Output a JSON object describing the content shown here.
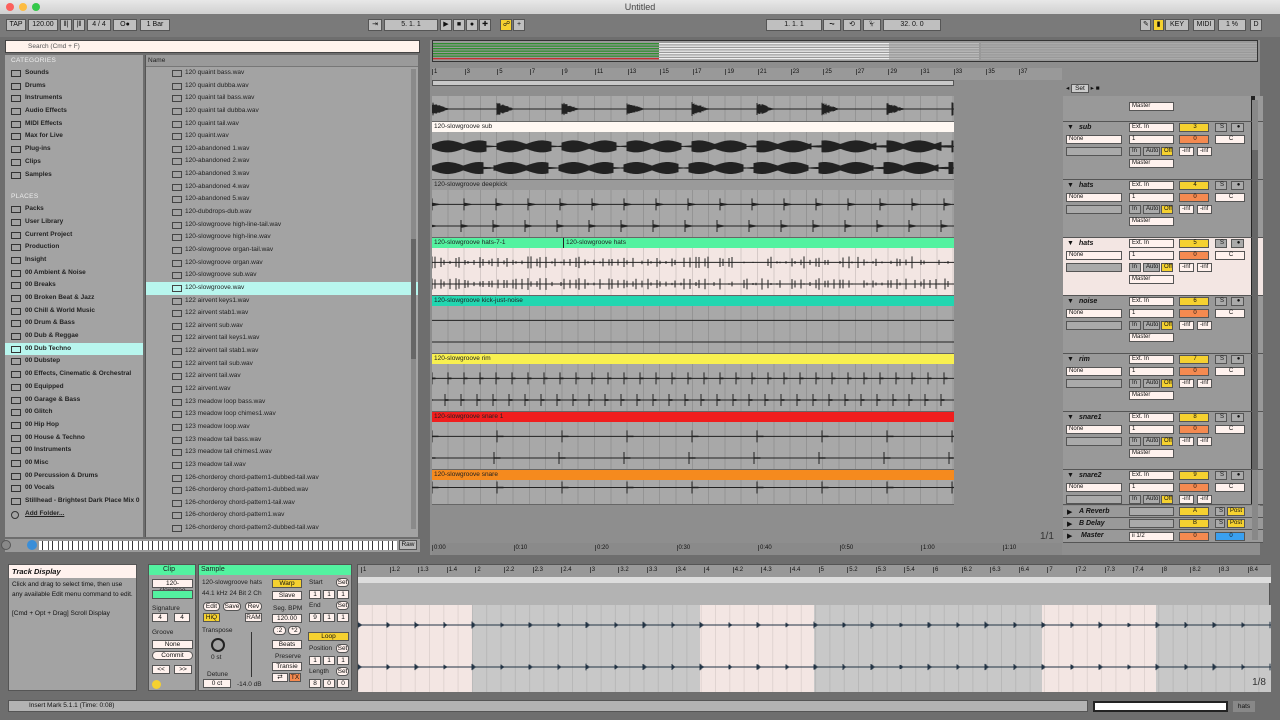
{
  "window": {
    "title": "Untitled"
  },
  "toolbar": {
    "tap": "TAP",
    "tempo": "120.00",
    "nudge_down": "⦀|",
    "nudge_up": "|⦀",
    "signature": "4 / 4",
    "metronome": "O●",
    "quantize": "1 Bar",
    "follow": "⇥",
    "position": "5.   1.   1",
    "arrangement_record": "☍",
    "draw": "+",
    "loop_start": "1.   1.   1",
    "punch_in": "⏦",
    "loop_toggle": "⟲",
    "punch_out": "⏧",
    "loop_length": "32.   0.   0",
    "pencil": "✎",
    "key": "KEY",
    "midi": "MIDI",
    "cpu": "1 %",
    "disk": "D"
  },
  "browser": {
    "search_placeholder": "Search (Cmd + F)",
    "categories_title": "CATEGORIES",
    "categories": [
      {
        "label": "Sounds",
        "icon": "note-icon"
      },
      {
        "label": "Drums",
        "icon": "grid-icon"
      },
      {
        "label": "Instruments",
        "icon": "wave-icon"
      },
      {
        "label": "Audio Effects",
        "icon": "effect-icon"
      },
      {
        "label": "MIDI Effects",
        "icon": "midi-effect-icon"
      },
      {
        "label": "Max for Live",
        "icon": "max-icon"
      },
      {
        "label": "Plug-ins",
        "icon": "plugin-icon"
      },
      {
        "label": "Clips",
        "icon": "clip-icon"
      },
      {
        "label": "Samples",
        "icon": "sample-icon"
      }
    ],
    "places_title": "PLACES",
    "places": [
      "Packs",
      "User Library",
      "Current Project",
      "Production",
      "Insight",
      "00 Ambient & Noise",
      "00 Breaks",
      "00 Broken Beat & Jazz",
      "00 Chill & World Music",
      "00 Drum & Bass",
      "00 Dub & Reggae",
      "00 Dub Techno",
      "00 Dubstep",
      "00 Effects, Cinematic & Orchestral",
      "00 Equipped",
      "00 Garage & Bass",
      "00 Glitch",
      "00 Hip Hop",
      "00 House & Techno",
      "00 Instruments",
      "00 Misc",
      "00 Percussion & Drums",
      "00 Vocals",
      "Stillhead - Brightest Dark Place Mix 0"
    ],
    "selected_place": "00 Dub Techno",
    "add_folder": "Add Folder...",
    "name_header": "Name",
    "files": [
      "120 quaint bass.wav",
      "120 quaint dubba.wav",
      "120 quaint tail bass.wav",
      "120 quaint tail dubba.wav",
      "120 quaint tail.wav",
      "120 quaint.wav",
      "120-abandoned 1.wav",
      "120-abandoned 2.wav",
      "120-abandoned 3.wav",
      "120-abandoned 4.wav",
      "120-abandoned 5.wav",
      "120-dubdrops-dub.wav",
      "120-slowgroove high-line-tail.wav",
      "120-slowgroove high-line.wav",
      "120-slowgroove organ-tail.wav",
      "120-slowgroove organ.wav",
      "120-slowgroove sub.wav",
      "120-slowgroove.wav",
      "122 airvent keys1.wav",
      "122 airvent stab1.wav",
      "122 airvent sub.wav",
      "122 airvent tail keys1.wav",
      "122 airvent tail stab1.wav",
      "122 airvent tail sub.wav",
      "122 airvent tail.wav",
      "122 airvent.wav",
      "123 meadow loop bass.wav",
      "123 meadow loop chimes1.wav",
      "123 meadow loop.wav",
      "123 meadow tail bass.wav",
      "123 meadow tail chimes1.wav",
      "123 meadow tail.wav",
      "126-chorderoy chord-pattern1-dubbed-tail.wav",
      "126-chorderoy chord-pattern1-dubbed.wav",
      "126-chorderoy chord-pattern1-tail.wav",
      "126-chorderoy chord-pattern1.wav",
      "126-chorderoy chord-pattern2-dubbed-tail.wav"
    ],
    "selected_file": "120-slowgroove.wav",
    "raw": "Raw"
  },
  "arrangement": {
    "bar_ticks": [
      "1",
      "3",
      "5",
      "7",
      "9",
      "11",
      "13",
      "15",
      "17",
      "19",
      "21",
      "23",
      "25",
      "27",
      "29",
      "31",
      "33",
      "35",
      "37"
    ],
    "time_ticks": [
      "0:00",
      "0:10",
      "0:20",
      "0:30",
      "0:40",
      "0:50",
      "1:00",
      "1:10"
    ],
    "set_label": "Set",
    "page": "1/1",
    "tracks": [
      {
        "name": "",
        "clips": [],
        "number": "",
        "output": "Master"
      },
      {
        "name": "sub",
        "clips": [
          {
            "label": "120-slowgroove sub",
            "color": "#fff8f3"
          }
        ],
        "number": "3",
        "input": "Ext. In",
        "input_channel": "None",
        "channel": "1",
        "monitor": [
          "In",
          "Auto",
          "Off"
        ],
        "output": "Master",
        "volume": "0",
        "pan": "C",
        "meters": [
          "-inf",
          "-inf"
        ],
        "solo": "S",
        "arm": "●"
      },
      {
        "name": "hats",
        "clips": [
          {
            "label": "120-slowgroove deepkick",
            "color": "#9a9a9a"
          }
        ],
        "number": "4",
        "input": "Ext. In",
        "input_channel": "None",
        "channel": "1",
        "monitor": [
          "In",
          "Auto",
          "Off"
        ],
        "output": "Master",
        "volume": "0",
        "pan": "C",
        "meters": [
          "-inf",
          "-inf"
        ],
        "solo": "S",
        "arm": "●"
      },
      {
        "name": "hats",
        "clips": [
          {
            "label": "120-slowgroove hats-7-1",
            "color": "#53f2a0"
          },
          {
            "label": "120-slowgroove hats",
            "color": "#53f2a0"
          }
        ],
        "number": "5",
        "input": "Ext. In",
        "input_channel": "None",
        "channel": "1",
        "monitor": [
          "In",
          "Auto",
          "Off"
        ],
        "output": "Master",
        "volume": "0",
        "pan": "C",
        "meters": [
          "-inf",
          "-inf"
        ],
        "solo": "S",
        "arm": "●",
        "selected": true
      },
      {
        "name": "noise",
        "clips": [
          {
            "label": "120-slowgroove kick-just-noise",
            "color": "#22d6b0"
          }
        ],
        "number": "6",
        "input": "Ext. In",
        "input_channel": "None",
        "channel": "1",
        "monitor": [
          "In",
          "Auto",
          "Off"
        ],
        "output": "Master",
        "volume": "0",
        "pan": "C",
        "meters": [
          "-inf",
          "-inf"
        ],
        "solo": "S",
        "arm": "●"
      },
      {
        "name": "rim",
        "clips": [
          {
            "label": "120-slowgroove rim",
            "color": "#f8f050"
          }
        ],
        "number": "7",
        "input": "Ext. In",
        "input_channel": "None",
        "channel": "1",
        "monitor": [
          "In",
          "Auto",
          "Off"
        ],
        "output": "Master",
        "volume": "0",
        "pan": "C",
        "meters": [
          "-inf",
          "-inf"
        ],
        "solo": "S",
        "arm": "●"
      },
      {
        "name": "snare1",
        "clips": [
          {
            "label": "120-slowgroove snare 1",
            "color": "#f01e1e"
          }
        ],
        "number": "8",
        "input": "Ext. In",
        "input_channel": "None",
        "channel": "1",
        "monitor": [
          "In",
          "Auto",
          "Off"
        ],
        "output": "Master",
        "volume": "0",
        "pan": "C",
        "meters": [
          "-inf",
          "-inf"
        ],
        "solo": "S",
        "arm": "●"
      },
      {
        "name": "snare2",
        "clips": [
          {
            "label": "120-slowgroove snare",
            "color": "#f58a1e"
          }
        ],
        "number": "9",
        "input": "Ext. In",
        "input_channel": "None",
        "channel": "1",
        "monitor": [
          "In",
          "Auto",
          "Off"
        ],
        "volume": "0",
        "pan": "C",
        "meters": [
          "-inf",
          "-inf"
        ],
        "solo": "S",
        "arm": "●"
      }
    ],
    "returns": [
      {
        "name": "A Reverb",
        "letter": "A",
        "solo": "S",
        "post": "Post"
      },
      {
        "name": "B Delay",
        "letter": "B",
        "solo": "S",
        "post": "Post"
      }
    ],
    "master": {
      "name": "Master",
      "cue": "ii 1/2",
      "volume": "0",
      "pan": "0"
    }
  },
  "info": {
    "title": "Track Display",
    "text": "Click and drag to select time, then use any available Edit menu command to edit.",
    "shortcut": "[Cmd + Opt + Drag] Scroll Display"
  },
  "clip": {
    "title": "Clip",
    "name": "120-slowgroo",
    "signature_label": "Signature",
    "sig_num": "4",
    "sig_den": "4",
    "groove_label": "Groove",
    "groove": "None",
    "commit": "Commit",
    "prev": "<<",
    "next": ">>"
  },
  "sample": {
    "title": "Sample",
    "file": "120-slowgroove hats",
    "format": "44.1 kHz 24 Bit 2 Ch",
    "edit": "Edit",
    "save": "Save",
    "rev": "Rev",
    "hiq": "HiQ",
    "ram": "RAM",
    "transpose_label": "Transpose",
    "transpose": "0 st",
    "detune_label": "Detune",
    "detune": "0 ct",
    "gain": "-14.0 dB",
    "warp": "Warp",
    "slave": "Slave",
    "seg_bpm_label": "Seg. BPM",
    "seg_bpm": "120.00",
    "half": ":2",
    "double": "*2",
    "warp_mode": "Beats",
    "preserve_label": "Preserve",
    "preserve": "Transie",
    "tx": "TX",
    "start_label": "Start",
    "start": [
      "1",
      "1",
      "1"
    ],
    "end_label": "End",
    "end": [
      "9",
      "1",
      "1"
    ],
    "set": "Set",
    "loop": "Loop",
    "position_label": "Position",
    "position": [
      "1",
      "1",
      "1"
    ],
    "length_label": "Length",
    "length": [
      "8",
      "0",
      "0"
    ]
  },
  "clip_editor": {
    "ticks": [
      "1",
      "1.2",
      "1.3",
      "1.4",
      "2",
      "2.2",
      "2.3",
      "2.4",
      "3",
      "3.2",
      "3.3",
      "3.4",
      "4",
      "4.2",
      "4.3",
      "4.4",
      "5",
      "5.2",
      "5.3",
      "5.4",
      "6",
      "6.2",
      "6.3",
      "6.4",
      "7",
      "7.2",
      "7.3",
      "7.4",
      "8",
      "8.2",
      "8.3",
      "8.4"
    ],
    "page": "1/8"
  },
  "status": {
    "text": "Insert Mark 5.1.1 (Time: 0:08)",
    "track": "hats"
  },
  "colors": {
    "accent": "#f5d130",
    "selected": "#b8f6ee",
    "clip_header": "#53f2a0",
    "volume": "#f58a50",
    "master_pan": "#3aa0f0"
  }
}
